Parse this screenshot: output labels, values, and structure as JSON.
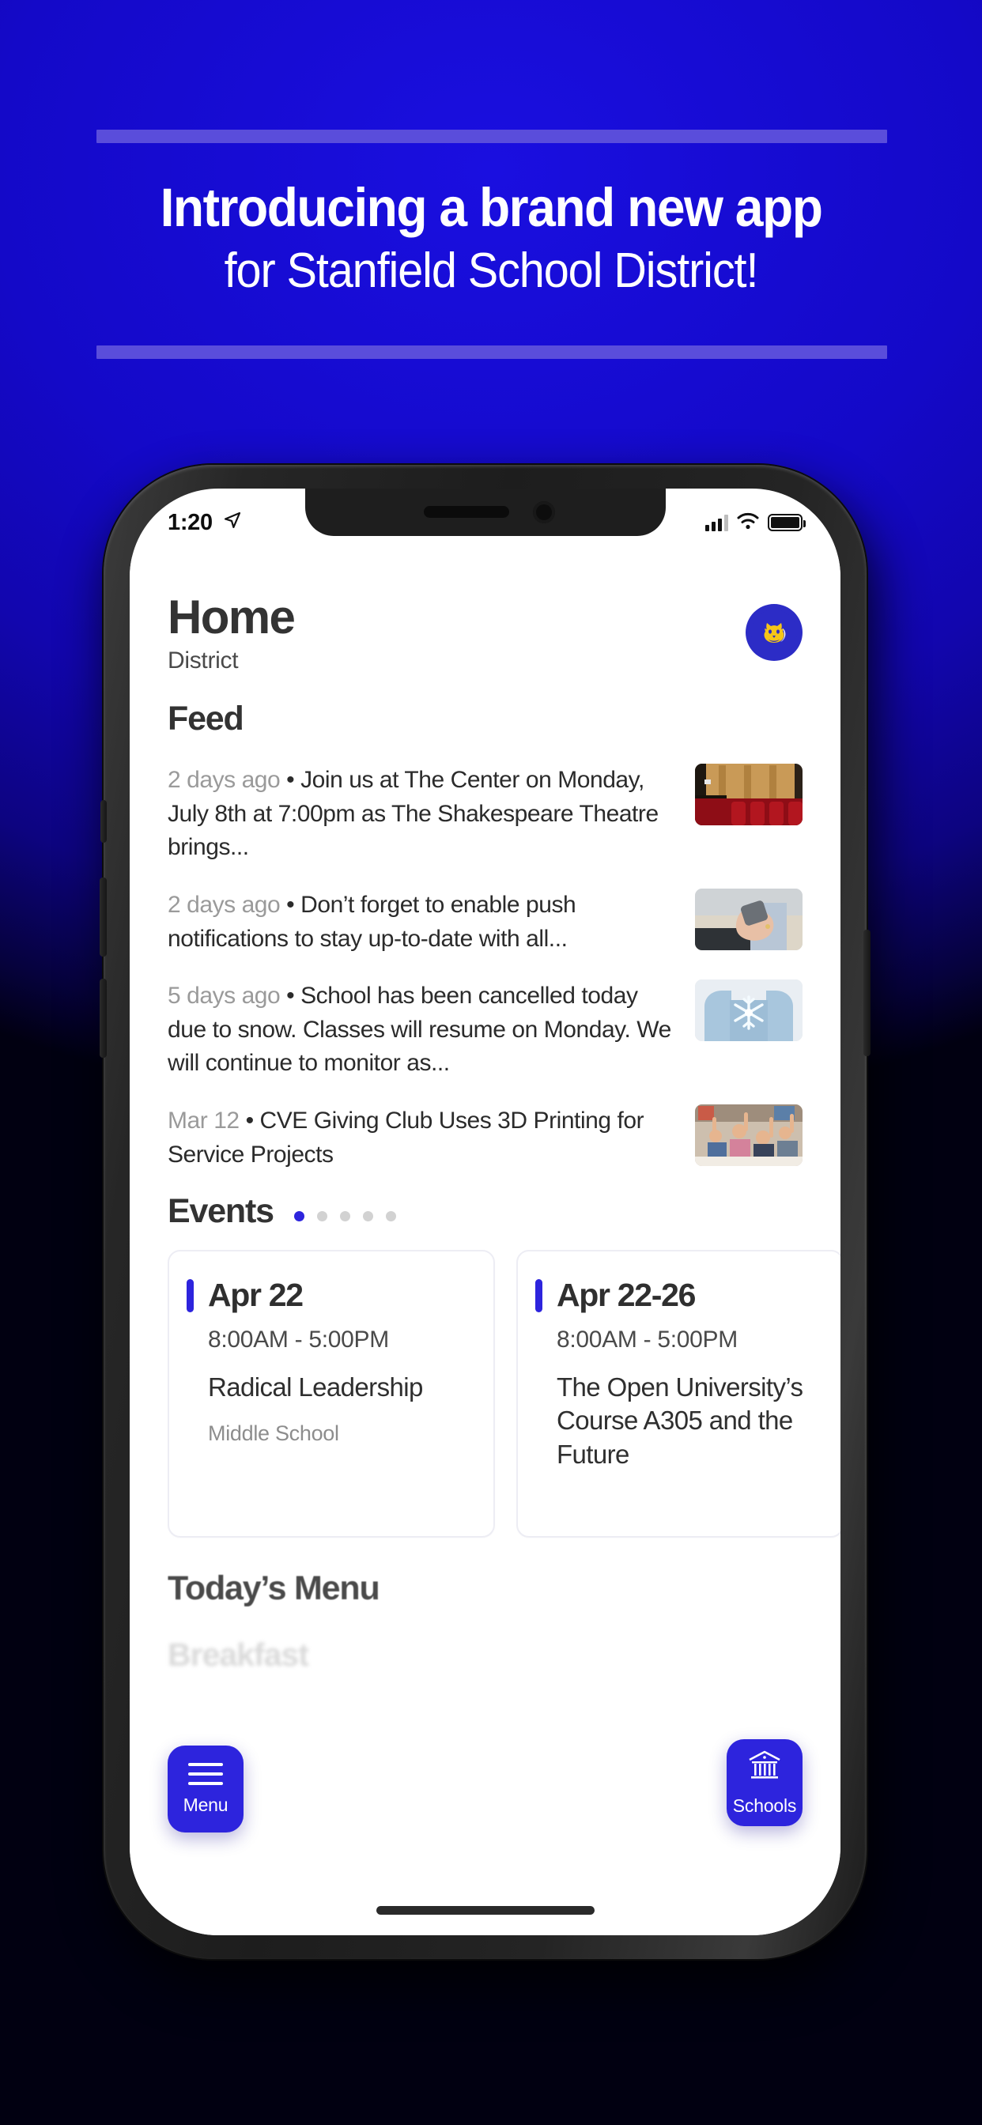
{
  "promo": {
    "title": "Introducing a brand new app",
    "subtitle": "for Stanfield School District!"
  },
  "phone": {
    "status_bar": {
      "time": "1:20",
      "location_icon": "location-arrow-icon",
      "signal_icon": "cellular-bars-icon",
      "wifi_icon": "wifi-icon",
      "battery_icon": "battery-full-icon"
    },
    "app": {
      "header": {
        "title": "Home",
        "subtitle": "District",
        "logo_icon": "district-tiger-logo"
      },
      "feed": {
        "section_title": "Feed",
        "items": [
          {
            "time": "2 days ago",
            "separator": "•",
            "text": "Join us at The Center on Monday, July 8th at 7:00pm as The Shakespeare Theatre brings...",
            "thumb": "theatre-seats-image"
          },
          {
            "time": "2 days ago",
            "separator": "•",
            "text": "Don’t forget to enable push notifications to stay up-to-date with all...",
            "thumb": "hands-phone-image"
          },
          {
            "time": "5 days ago",
            "separator": "•",
            "text": "School has been cancelled today due to snow. Classes will resume on Monday. We will continue to monitor as...",
            "thumb": "snowflake-mittens-image"
          },
          {
            "time": "Mar 12",
            "separator": "•",
            "text": "CVE Giving Club Uses 3D Printing for Service Projects",
            "thumb": "classroom-students-image"
          }
        ]
      },
      "events": {
        "section_title": "Events",
        "page_dots": 5,
        "active_dot": 1,
        "cards": [
          {
            "date": "Apr 22",
            "time": "8:00AM  -  5:00PM",
            "name": "Radical Leadership",
            "location": "Middle School"
          },
          {
            "date": "Apr 22-26",
            "time": "8:00AM  -  5:00PM",
            "name": "The Open University’s Course A305 and the Future",
            "location": ""
          }
        ]
      },
      "menu": {
        "section_title": "Today’s Menu",
        "meal": "Breakfast"
      },
      "fabs": [
        {
          "label": "Menu",
          "icon": "hamburger-menu-icon"
        },
        {
          "label": "Schools",
          "icon": "bank-building-icon"
        }
      ]
    }
  },
  "colors": {
    "background": "#1409c8",
    "accent": "#2d24dd",
    "rule": "#5a4ddb",
    "text_dark": "#333333",
    "text_muted": "#9a9a9a"
  }
}
